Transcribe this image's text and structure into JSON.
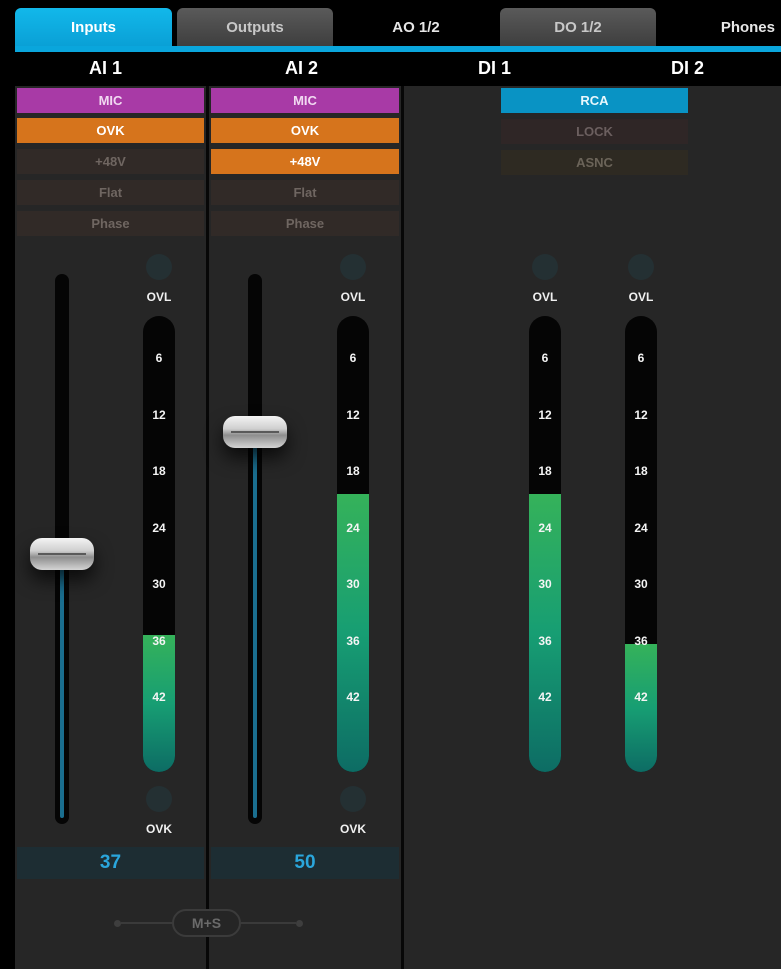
{
  "tabs": [
    {
      "label": "Inputs",
      "state": "active"
    },
    {
      "label": "Outputs",
      "state": "inactive"
    },
    {
      "label": "AO 1/2",
      "state": "inactive"
    },
    {
      "label": "DO 1/2",
      "state": "inactive"
    },
    {
      "label": "Phones",
      "state": "inactive"
    }
  ],
  "channels": {
    "ai1": {
      "name": "AI 1",
      "buttons": {
        "mic": "MIC",
        "ovk": "OVK",
        "phantom": "+48V",
        "flat": "Flat",
        "phase": "Phase"
      },
      "ovl_label": "OVL",
      "ovk_label": "OVK",
      "meter_ticks": [
        "6",
        "12",
        "18",
        "24",
        "30",
        "36",
        "42"
      ],
      "meter_level_fraction": 0.3,
      "fader_level_fraction": 0.49,
      "value": "37"
    },
    "ai2": {
      "name": "AI 2",
      "buttons": {
        "mic": "MIC",
        "ovk": "OVK",
        "phantom": "+48V",
        "flat": "Flat",
        "phase": "Phase"
      },
      "ovl_label": "OVL",
      "ovk_label": "OVK",
      "meter_ticks": [
        "6",
        "12",
        "18",
        "24",
        "30",
        "36",
        "42"
      ],
      "meter_level_fraction": 0.61,
      "fader_level_fraction": 0.72,
      "value": "50"
    },
    "di1": {
      "name": "DI 1",
      "buttons": {
        "rca": "RCA",
        "lock": "LOCK",
        "asnc": "ASNC"
      },
      "ovl_label": "OVL",
      "meter_ticks": [
        "6",
        "12",
        "18",
        "24",
        "30",
        "36",
        "42"
      ],
      "meter_level_fraction": 0.61
    },
    "di2": {
      "name": "DI 2",
      "ovl_label": "OVL",
      "meter_ticks": [
        "6",
        "12",
        "18",
        "24",
        "30",
        "36",
        "42"
      ],
      "meter_level_fraction": 0.28
    }
  },
  "ms_link_label": "M+S",
  "colors": {
    "accent": "#0aa6dc",
    "mic_on": "#a83aa6",
    "ovk_on": "#d6741c",
    "rca_on": "#0993c4",
    "meter_green": "#35b25a",
    "meter_teal": "#0d6c64",
    "value_text": "#2aa6dc"
  }
}
